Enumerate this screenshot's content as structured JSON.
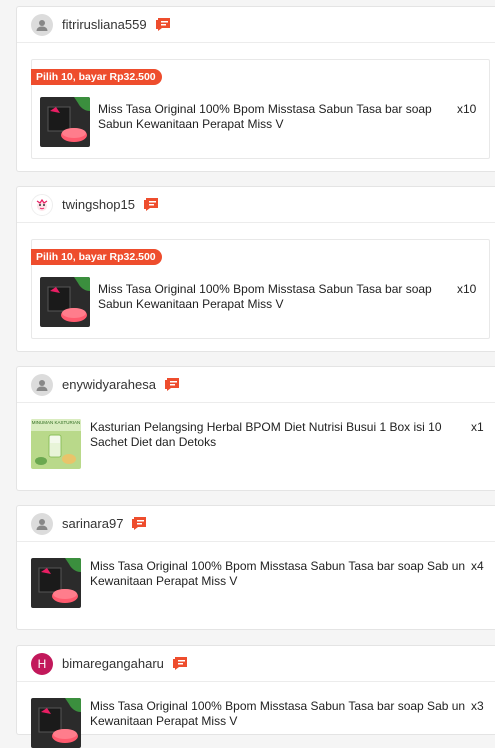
{
  "orders": [
    {
      "user": "fitrirusliana559",
      "avatar": "default",
      "bundle_label": "Pilih 10, bayar Rp32.500",
      "product": "Miss Tasa Original 100% Bpom Misstasa Sabun Tasa bar soap Sabun Kewanitaan Perapat Miss V",
      "qty": "x10",
      "thumb": "soap"
    },
    {
      "user": "twingshop15",
      "avatar": "shop",
      "bundle_label": "Pilih 10, bayar Rp32.500",
      "product": "Miss Tasa Original 100% Bpom Misstasa Sabun Tasa bar soap Sabun Kewanitaan Perapat Miss V",
      "qty": "x10",
      "thumb": "soap"
    },
    {
      "user": "enywidyarahesa",
      "avatar": "default",
      "product": "Kasturian Pelangsing Herbal BPOM Diet Nutrisi Busui 1 Box isi 10 Sachet Diet dan Detoks",
      "qty": "x1",
      "thumb": "drink",
      "thumb_text": "MINUMAN KASTURIAN"
    },
    {
      "user": "sarinara97",
      "avatar": "default",
      "product": "Miss Tasa Original 100% Bpom Misstasa Sabun Tasa bar soap Sab un Kewanitaan Perapat Miss V",
      "qty": "x4",
      "thumb": "soap"
    },
    {
      "user": "bimaregangaharu",
      "avatar": "letter",
      "avatar_letter": "H",
      "product": "Miss Tasa Original 100% Bpom Misstasa Sabun Tasa bar soap Sab un Kewanitaan Perapat Miss V",
      "qty": "x3",
      "thumb": "soap"
    }
  ],
  "colors": {
    "accent": "#ee4d2d",
    "letter_avatar": "#c2185b"
  }
}
